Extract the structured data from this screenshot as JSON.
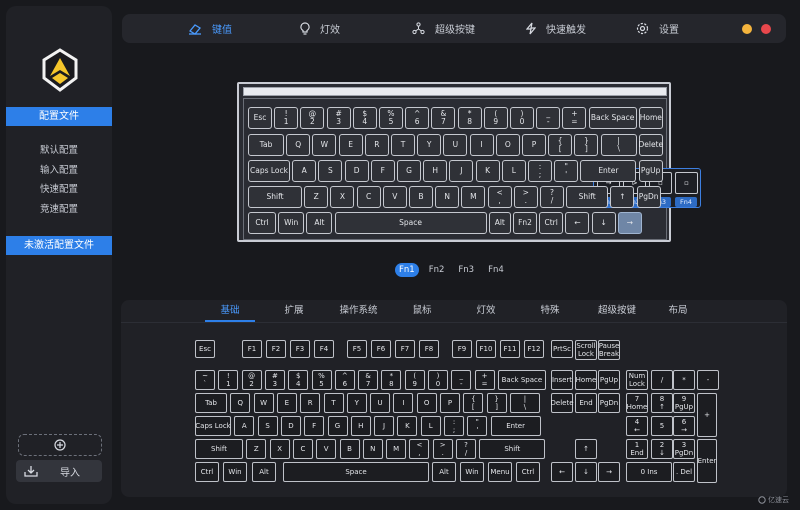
{
  "colors": {
    "accent": "#2d7fe8",
    "accent_text": "#4a9bff",
    "background": "#18191d",
    "panel": "#202126",
    "minimize": "#f4b43d",
    "close": "#e8474c"
  },
  "sidebar": {
    "section_profiles": "配置文件",
    "profiles": [
      "默认配置",
      "输入配置",
      "快速配置",
      "竞速配置"
    ],
    "section_inactive": "未激活配置文件",
    "add_icon": "plus-circle-icon",
    "import_label": "导入"
  },
  "topnav": {
    "items": [
      {
        "label": "键值",
        "icon": "keycap-icon",
        "active": true
      },
      {
        "label": "灯效",
        "icon": "bulb-icon",
        "active": false
      },
      {
        "label": "超级按键",
        "icon": "nodes-icon",
        "active": false
      },
      {
        "label": "快速触发",
        "icon": "bolt-icon",
        "active": false
      },
      {
        "label": "设置",
        "icon": "gear-icon",
        "active": false
      }
    ]
  },
  "keyboard_rows": [
    [
      "Esc",
      "!\n1",
      "@\n2",
      "#\n3",
      "$\n4",
      "%\n5",
      "^\n6",
      "&\n7",
      "*\n8",
      "(\n9",
      ")\n0",
      "_\n-",
      "+\n=",
      "Back Space",
      "Home"
    ],
    [
      "Tab",
      "Q",
      "W",
      "E",
      "R",
      "T",
      "Y",
      "U",
      "I",
      "O",
      "P",
      "{\n[",
      "}\n]",
      "|\n\\",
      "Delete"
    ],
    [
      "Caps Lock",
      "A",
      "S",
      "D",
      "F",
      "G",
      "H",
      "J",
      "K",
      "L",
      ":\n;",
      "\"\n'",
      "Enter",
      "PgUp"
    ],
    [
      "Shift",
      "Z",
      "X",
      "C",
      "V",
      "B",
      "N",
      "M",
      "<\n,",
      ">\n.",
      "?\n/",
      "Shift",
      "↑",
      "PgDn"
    ],
    [
      "Ctrl",
      "Win",
      "Alt",
      "Space",
      "Alt",
      "Fn2",
      "Ctrl",
      "←",
      "↓",
      "→"
    ]
  ],
  "fn_popup": {
    "cells": [
      "→",
      "⊳",
      "▫",
      "▫"
    ],
    "tags": [
      "Fn1",
      "Fn2",
      "Fn3",
      "Fn4"
    ]
  },
  "fn_layers": [
    "Fn1",
    "Fn2",
    "Fn3",
    "Fn4"
  ],
  "categories": [
    "基础",
    "扩展",
    "操作系统",
    "鼠标",
    "灯效",
    "特殊",
    "超级按键",
    "布局"
  ],
  "fullkb": {
    "row1": [
      "Esc",
      "F1",
      "F2",
      "F3",
      "F4",
      "F5",
      "F6",
      "F7",
      "F8",
      "F9",
      "F10",
      "F11",
      "F12",
      "PrtSc",
      "Scroll\nLock",
      "Pause\nBreak"
    ],
    "row2": [
      "~\n`",
      "!\n1",
      "@\n2",
      "#\n3",
      "$\n4",
      "%\n5",
      "^\n6",
      "&\n7",
      "*\n8",
      "(\n9",
      ")\n0",
      "_\n-",
      "+\n=",
      "Back Space",
      "Insert",
      "Home",
      "PgUp",
      "Num\nLock",
      "/",
      "*",
      "-"
    ],
    "row3": [
      "Tab",
      "Q",
      "W",
      "E",
      "R",
      "T",
      "Y",
      "U",
      "I",
      "O",
      "P",
      "{\n[",
      "}\n]",
      "|\n\\",
      "Delete",
      "End",
      "PgDn",
      "7\nHome",
      "8\n↑",
      "9\nPgUp",
      "+"
    ],
    "row4": [
      "Caps Lock",
      "A",
      "S",
      "D",
      "F",
      "G",
      "H",
      "J",
      "K",
      "L",
      ":\n;",
      "\"\n'",
      "Enter",
      "4\n←",
      "5",
      "6\n→"
    ],
    "row5": [
      "Shift",
      "Z",
      "X",
      "C",
      "V",
      "B",
      "N",
      "M",
      "<\n,",
      ">\n.",
      "?\n/",
      "Shift",
      "↑",
      "1\nEnd",
      "2\n↓",
      "3\nPgDn",
      "Enter"
    ],
    "row6": [
      "Ctrl",
      "Win",
      "Alt",
      "Space",
      "Alt",
      "Win",
      "Menu",
      "Ctrl",
      "←",
      "↓",
      "→",
      "0 Ins",
      ". Del"
    ]
  },
  "watermark": "亿速云"
}
